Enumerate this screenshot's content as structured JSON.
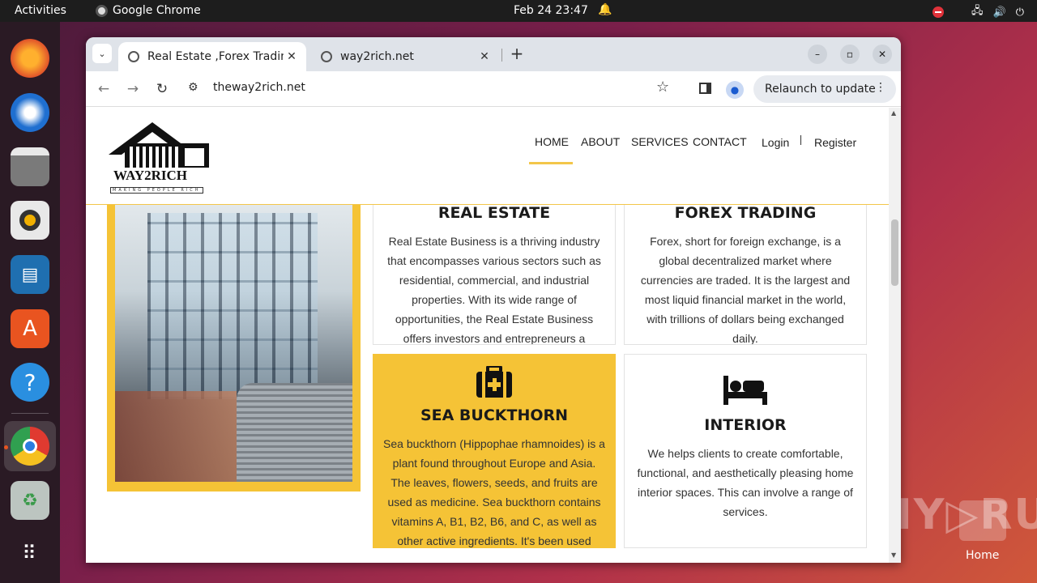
{
  "topbar": {
    "activities": "Activities",
    "app_name": "Google Chrome",
    "clock": "Feb 24  23:47"
  },
  "dock": {
    "items": [
      "firefox-icon",
      "thunderbird-icon",
      "files-icon",
      "rhythmbox-icon",
      "writer-icon",
      "software-center-icon",
      "help-icon",
      "chrome-icon",
      "trash-icon",
      "app-grid-icon"
    ]
  },
  "desktop": {
    "home_label": "Home",
    "watermark": "ANY▷RUN"
  },
  "browser": {
    "tabs": [
      {
        "title": "Real Estate ,Forex Trading",
        "active": true
      },
      {
        "title": "way2rich.net",
        "active": false
      }
    ],
    "url": "theway2rich.net",
    "relaunch_label": "Relaunch to update"
  },
  "site": {
    "logo_word": "WAY2RICH",
    "logo_tagline": "MAKING PEOPLE RICH",
    "menu": [
      "HOME",
      "ABOUT",
      "SERVICES",
      "CONTACT"
    ],
    "auth": {
      "login": "Login",
      "register": "Register"
    },
    "cards": {
      "real_estate": {
        "title": "REAL ESTATE",
        "body": "Real Estate Business is a thriving industry that encompasses various sectors such as residential, commercial, and industrial properties. With its wide range of opportunities, the Real Estate Business offers investors and entrepreneurs a platform to generate substantial income."
      },
      "forex": {
        "title": "FOREX TRADING",
        "body": "Forex, short for foreign exchange, is a global decentralized market where currencies are traded. It is the largest and most liquid financial market in the world, with trillions of dollars being exchanged daily."
      },
      "sea_buckthorn": {
        "title": "SEA BUCKTHORN",
        "body": "Sea buckthorn (Hippophae rhamnoides) is a plant found throughout Europe and Asia. The leaves, flowers, seeds, and fruits are used as medicine. Sea buckthorn contains vitamins A, B1, B2, B6, and C, as well as other active ingredients. It's been used traditionally to slow down the aging"
      },
      "interior": {
        "title": "INTERIOR",
        "body": "We helps clients to create comfortable, functional, and aesthetically pleasing home interior spaces. This can involve a range of services."
      }
    }
  },
  "colors": {
    "accent": "#f5c336",
    "ubuntu_orange": "#e95420"
  }
}
